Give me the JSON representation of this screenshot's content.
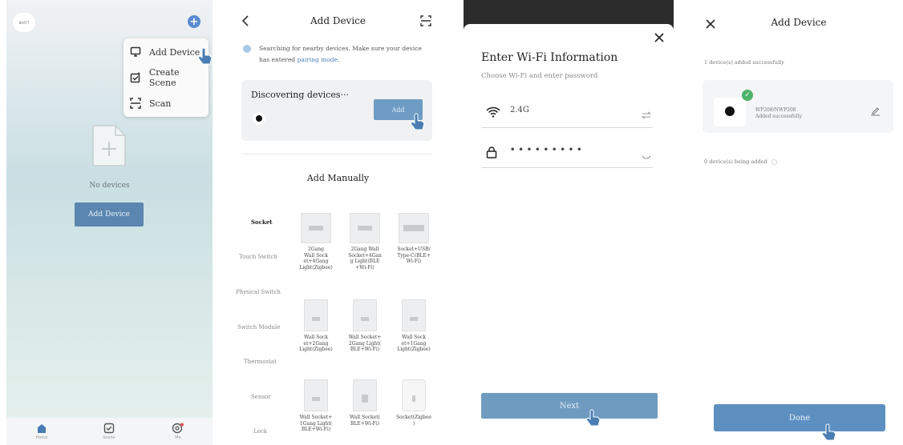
{
  "screen1": {
    "brand_logo_text": "BAATT",
    "menu_items": [
      {
        "label": "Add Device",
        "icon": "add-device-icon"
      },
      {
        "label": "Create Scene",
        "icon": "create-scene-icon"
      },
      {
        "label": "Scan",
        "icon": "scan-icon"
      }
    ],
    "empty_text": "No devices",
    "add_button": "Add Device",
    "tabs": [
      {
        "label": "Home",
        "icon": "home-icon"
      },
      {
        "label": "Scene",
        "icon": "scene-icon"
      },
      {
        "label": "Me",
        "icon": "profile-icon"
      }
    ]
  },
  "screen2": {
    "title": "Add Device",
    "search_text": "Searching for nearby devices. Make sure your device",
    "search_text2": "has entered",
    "pairing_link": "pairing mode",
    "search_text_end": ".",
    "discovering_label": "Discovering devices···",
    "add_label": "Add",
    "manual_title": "Add Manually",
    "categories": [
      "Socket",
      "Touch Switch",
      "Physical Switch",
      "Switch Module",
      "Thermostat",
      "Sensor",
      "Lock"
    ],
    "products": [
      "2Gang\nWall Sock\net+4Gang\nLight(Zigbee)",
      "2Gang Wall\nSocket+4Gan\ng Light(BLE\n+Wi-Fi)",
      "Socket+USB/\nType-C(BLE+\nWi-Fi)",
      "Wall Sock\net+2Gang\nLight(Zigbee)",
      "Wall Socket+\n2Gang Light(\nBLE+Wi-Fi)",
      "Wall Sock\net+1Gang\nLight(Zigbee)",
      "Wall Socket+\n1Gang Light(\nBLE+Wi-Fi)",
      "Wall Socket(\nBLE+Wi-Fi)",
      "Socket(Zigbee\n)"
    ]
  },
  "screen3": {
    "title": "Enter Wi-Fi Information",
    "subtitle": "Choose Wi-Fi and enter password",
    "wifi_name": "2.4G",
    "password_mask": "•••••••••",
    "next_label": "Next"
  },
  "screen4": {
    "title": "Add Device",
    "added_text": "1 device(s) added successfully",
    "device_name": "WP208/NWP208",
    "device_status": "Added successfully",
    "being_added_text": "0 device(s) being added",
    "done_label": "Done"
  },
  "colors": {
    "primary_blue": "#5a86b0",
    "success_green": "#4db36a"
  }
}
